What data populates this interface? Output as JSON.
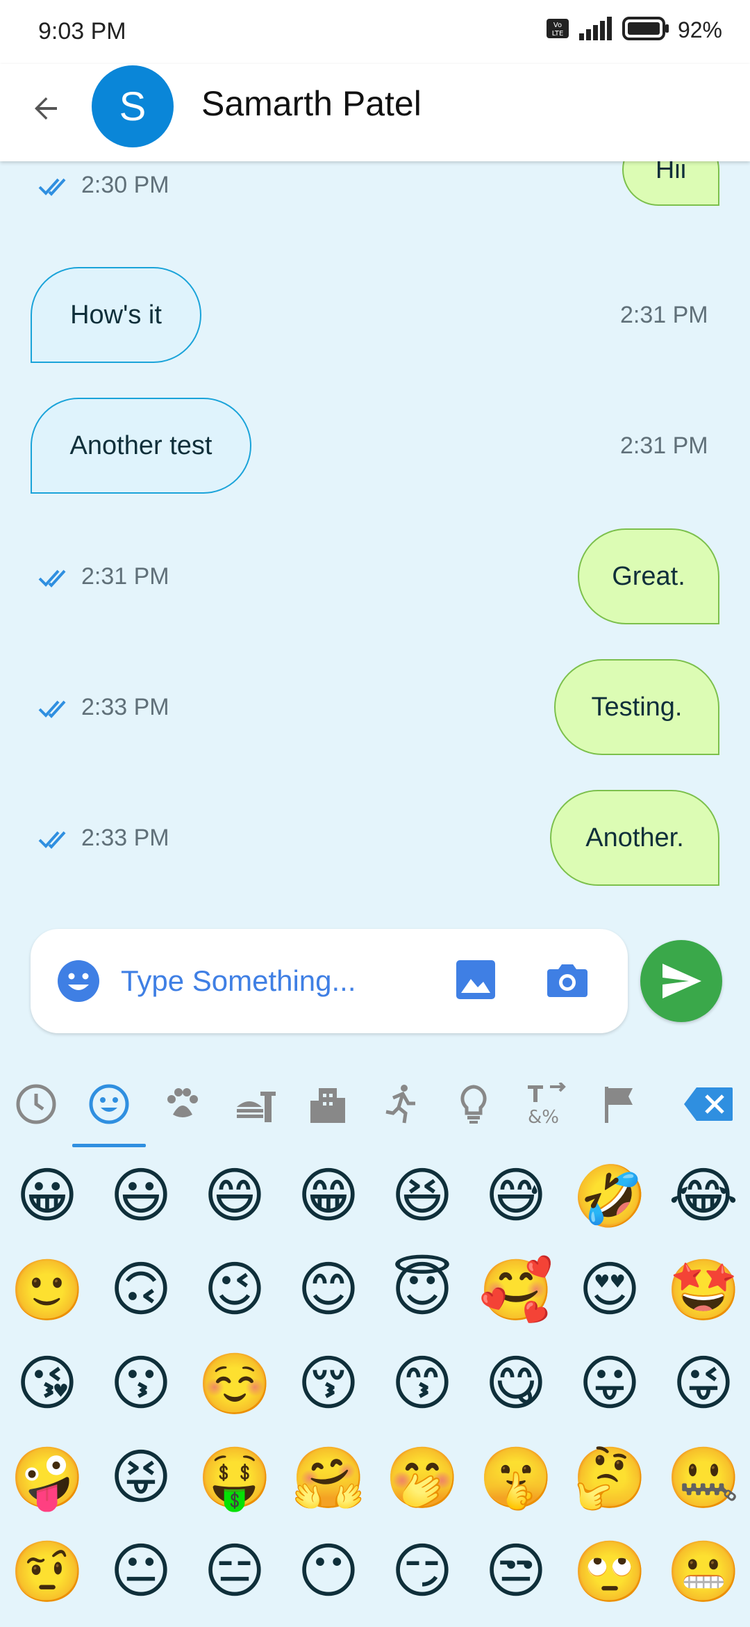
{
  "status_bar": {
    "time": "9:03 PM",
    "battery": "92%"
  },
  "header": {
    "avatar_letter": "S",
    "contact_name": "Samarth Patel"
  },
  "messages": [
    {
      "type": "sent",
      "text": "Hii",
      "time": "2:30 PM"
    },
    {
      "type": "received",
      "text": "How's it",
      "time": "2:31 PM"
    },
    {
      "type": "received",
      "text": "Another test",
      "time": "2:31 PM"
    },
    {
      "type": "sent",
      "text": "Great.",
      "time": "2:31 PM"
    },
    {
      "type": "sent",
      "text": "Testing.",
      "time": "2:33 PM"
    },
    {
      "type": "sent",
      "text": "Another.",
      "time": "2:33 PM"
    }
  ],
  "input": {
    "placeholder": "Type Something..."
  },
  "emoji_picker": {
    "categories": [
      "recent",
      "smileys",
      "animals",
      "food",
      "travel",
      "activities",
      "objects",
      "symbols",
      "flags",
      "backspace"
    ],
    "selected_category": "smileys",
    "emojis": [
      "😀",
      "😃",
      "😄",
      "😁",
      "😆",
      "😅",
      "🤣",
      "😂",
      "🙂",
      "🙃",
      "😉",
      "😊",
      "😇",
      "🥰",
      "😍",
      "🤩",
      "😘",
      "😗",
      "☺️",
      "😚",
      "😙",
      "😋",
      "😛",
      "😜",
      "🤪",
      "😝",
      "🤑",
      "🤗",
      "🤭",
      "🤫",
      "🤔",
      "🤐",
      "🤨",
      "😐",
      "😑",
      "😶",
      "😏",
      "😒",
      "🙄",
      "😬"
    ]
  },
  "colors": {
    "accent": "#2f8fe0",
    "send": "#3aa84a",
    "sent_bubble": "#dcfcb4",
    "received_bubble": "#dff3fc"
  }
}
